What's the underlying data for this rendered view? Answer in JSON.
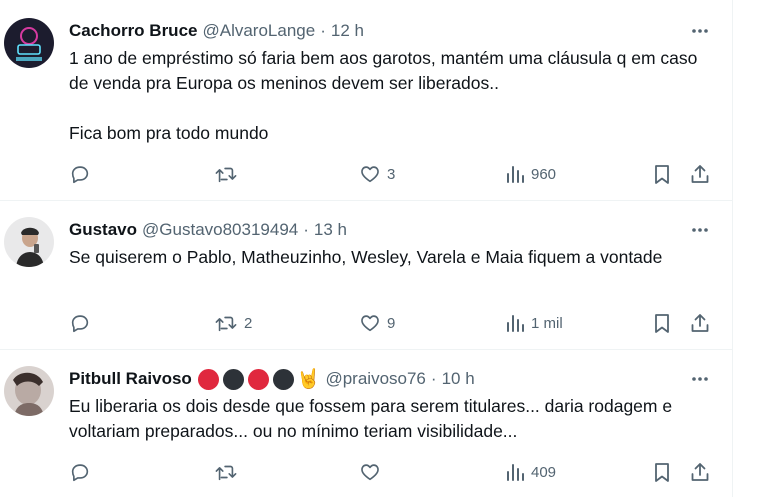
{
  "tweets": [
    {
      "name": "Cachorro Bruce",
      "handle": "@AlvaroLange",
      "separator": "·",
      "time": "12 h",
      "text": "1 ano de empréstimo só faria bem aos garotos, mantém uma cláusula q em caso de venda pra Europa os meninos devem ser liberados..\n\nFica bom pra todo mundo",
      "replies": "",
      "retweets": "",
      "likes": "3",
      "views": "960",
      "avatar_colors": [
        "#1c1c2e",
        "#d63aa0",
        "#5fe2ff"
      ]
    },
    {
      "name": "Gustavo",
      "handle": "@Gustavo80319494",
      "separator": "·",
      "time": "13 h",
      "text": "Se quiserem o Pablo, Matheuzinho, Wesley, Varela e Maia fiquem a vontade",
      "replies": "",
      "retweets": "2",
      "likes": "9",
      "views": "1 mil",
      "avatar_colors": [
        "#e9e9ea",
        "#2a2a2a",
        "#c9a58d"
      ]
    },
    {
      "name": "Pitbull Raivoso",
      "handle": "@praivoso76",
      "separator": "·",
      "time": "10 h",
      "text": "Eu liberaria os dois desde que fossem para serem titulares... daria rodagem e voltariam preparados... ou no mínimo teriam visibilidade...",
      "replies": "",
      "retweets": "",
      "likes": "",
      "views": "409",
      "avatar_colors": [
        "#d9d2cf",
        "#7d6b66",
        "#3b2f2c"
      ],
      "name_badges": [
        "#e0283e",
        "#2d3238",
        "#e0283e",
        "#2d3238"
      ],
      "name_emoji": "🤘"
    }
  ],
  "colors": {
    "text": "#0f1419",
    "secondary": "#536471",
    "divider": "#eff3f4"
  },
  "icons": [
    "reply-icon",
    "retweet-icon",
    "like-icon",
    "views-icon",
    "bookmark-icon",
    "share-icon",
    "more-icon"
  ]
}
